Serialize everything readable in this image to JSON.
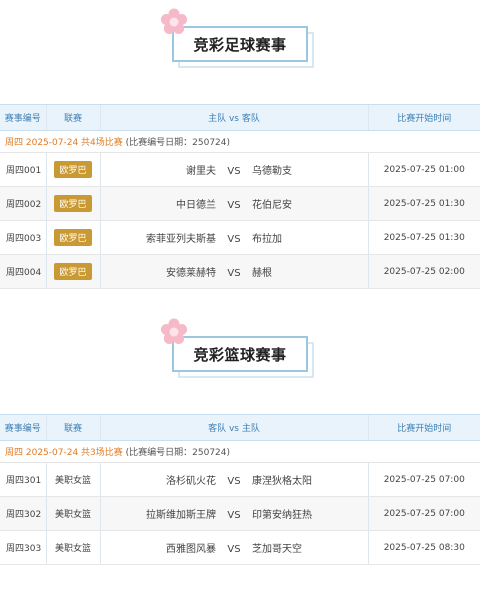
{
  "football": {
    "title": "竞彩足球赛事",
    "headers": [
      "赛事编号",
      "联赛",
      "主队 vs 客队",
      "比赛开始时间"
    ],
    "date_highlight": "周四 2025-07-24 共4场比赛",
    "date_note": " (比赛编号日期：250724)",
    "matches": [
      {
        "id": "周四001",
        "league": "欧罗巴",
        "home": "谢里夫",
        "vs": "VS",
        "away": "乌德勒支",
        "time": "2025-07-25 01:00"
      },
      {
        "id": "周四002",
        "league": "欧罗巴",
        "home": "中日德兰",
        "vs": "VS",
        "away": "花伯尼安",
        "time": "2025-07-25 01:30"
      },
      {
        "id": "周四003",
        "league": "欧罗巴",
        "home": "索菲亚列夫斯基",
        "vs": "VS",
        "away": "布拉加",
        "time": "2025-07-25 01:30"
      },
      {
        "id": "周四004",
        "league": "欧罗巴",
        "home": "安德莱赫特",
        "vs": "VS",
        "away": "赫根",
        "time": "2025-07-25 02:00"
      }
    ]
  },
  "basketball": {
    "title": "竞彩篮球赛事",
    "headers": [
      "赛事编号",
      "联赛",
      "客队 vs 主队",
      "比赛开始时间"
    ],
    "date_highlight": "周四 2025-07-24 共3场比赛",
    "date_note": " (比赛编号日期：250724)",
    "matches": [
      {
        "id": "周四301",
        "league": "美职女篮",
        "home": "洛杉矶火花",
        "vs": "VS",
        "away": "康涅狄格太阳",
        "time": "2025-07-25 07:00"
      },
      {
        "id": "周四302",
        "league": "美职女篮",
        "home": "拉斯维加斯王牌",
        "vs": "VS",
        "away": "印第安纳狂热",
        "time": "2025-07-25 07:00"
      },
      {
        "id": "周四303",
        "league": "美职女篮",
        "home": "西雅图风暴",
        "vs": "VS",
        "away": "芝加哥天空",
        "time": "2025-07-25 08:30"
      }
    ]
  },
  "colors": {
    "accent": "#3d7fb5",
    "badge": "#c99a33",
    "date_highlight": "#e07b24",
    "title_border": "#9cc7e0"
  },
  "icons": {
    "title_decoration": "flower-icon"
  }
}
